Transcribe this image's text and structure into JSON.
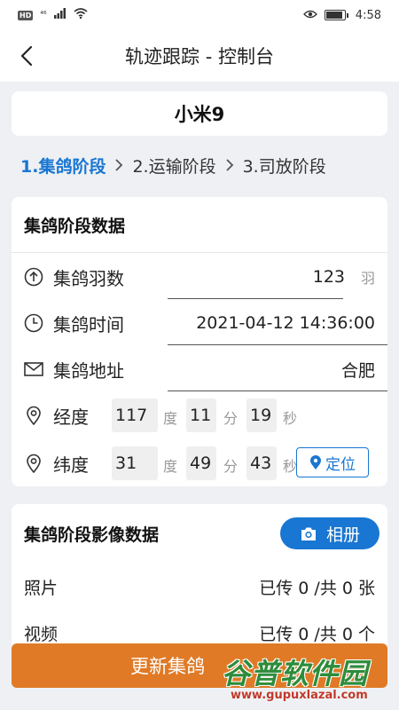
{
  "status_bar": {
    "hd": "HD",
    "signal": "⁴⁶",
    "time": "4:58",
    "battery_level": 0.85
  },
  "header": {
    "title": "轨迹跟踪 - 控制台"
  },
  "device": {
    "name": "小米9"
  },
  "steps": [
    {
      "label": "1.集鸽阶段",
      "active": true
    },
    {
      "label": "2.运输阶段",
      "active": false
    },
    {
      "label": "3.司放阶段",
      "active": false
    }
  ],
  "section1": {
    "title": "集鸽阶段数据",
    "count": {
      "label": "集鸽羽数",
      "value": "123",
      "unit": "羽"
    },
    "time": {
      "label": "集鸽时间",
      "value": "2021-04-12 14:36:00"
    },
    "address": {
      "label": "集鸽地址",
      "value": "合肥"
    },
    "longitude": {
      "label": "经度",
      "deg": "117",
      "deg_unit": "度",
      "min": "11",
      "min_unit": "分",
      "sec": "19",
      "sec_unit": "秒"
    },
    "latitude": {
      "label": "纬度",
      "deg": "31",
      "deg_unit": "度",
      "min": "49",
      "min_unit": "分",
      "sec": "43",
      "sec_unit": "秒"
    },
    "locate_button": "定位"
  },
  "section2": {
    "title": "集鸽阶段影像数据",
    "album_button": "相册",
    "photos": {
      "label": "照片",
      "status": "已传 0 /共 0 张"
    },
    "videos": {
      "label": "视频",
      "status": "已传 0 /共 0 个"
    }
  },
  "footer": {
    "update_button": "更新集鸽"
  },
  "watermark": {
    "text": "谷普软件园",
    "url": "www.gupuxlazal.com"
  },
  "colors": {
    "accent": "#1976d2",
    "update_button": "#e07a26",
    "background": "#eef0f3"
  }
}
